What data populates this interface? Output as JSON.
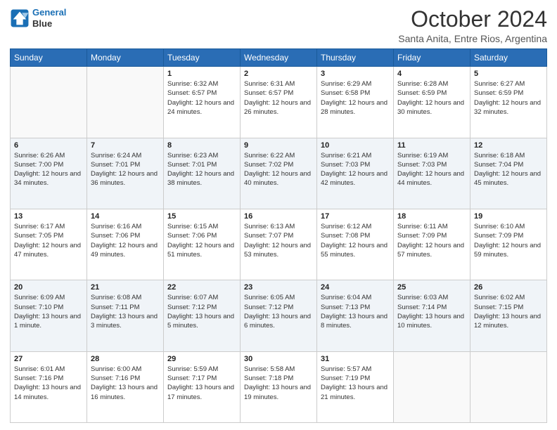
{
  "logo": {
    "line1": "General",
    "line2": "Blue"
  },
  "title": "October 2024",
  "subtitle": "Santa Anita, Entre Rios, Argentina",
  "days_of_week": [
    "Sunday",
    "Monday",
    "Tuesday",
    "Wednesday",
    "Thursday",
    "Friday",
    "Saturday"
  ],
  "weeks": [
    [
      {
        "day": "",
        "info": ""
      },
      {
        "day": "",
        "info": ""
      },
      {
        "day": "1",
        "info": "Sunrise: 6:32 AM\nSunset: 6:57 PM\nDaylight: 12 hours and 24 minutes."
      },
      {
        "day": "2",
        "info": "Sunrise: 6:31 AM\nSunset: 6:57 PM\nDaylight: 12 hours and 26 minutes."
      },
      {
        "day": "3",
        "info": "Sunrise: 6:29 AM\nSunset: 6:58 PM\nDaylight: 12 hours and 28 minutes."
      },
      {
        "day": "4",
        "info": "Sunrise: 6:28 AM\nSunset: 6:59 PM\nDaylight: 12 hours and 30 minutes."
      },
      {
        "day": "5",
        "info": "Sunrise: 6:27 AM\nSunset: 6:59 PM\nDaylight: 12 hours and 32 minutes."
      }
    ],
    [
      {
        "day": "6",
        "info": "Sunrise: 6:26 AM\nSunset: 7:00 PM\nDaylight: 12 hours and 34 minutes."
      },
      {
        "day": "7",
        "info": "Sunrise: 6:24 AM\nSunset: 7:01 PM\nDaylight: 12 hours and 36 minutes."
      },
      {
        "day": "8",
        "info": "Sunrise: 6:23 AM\nSunset: 7:01 PM\nDaylight: 12 hours and 38 minutes."
      },
      {
        "day": "9",
        "info": "Sunrise: 6:22 AM\nSunset: 7:02 PM\nDaylight: 12 hours and 40 minutes."
      },
      {
        "day": "10",
        "info": "Sunrise: 6:21 AM\nSunset: 7:03 PM\nDaylight: 12 hours and 42 minutes."
      },
      {
        "day": "11",
        "info": "Sunrise: 6:19 AM\nSunset: 7:03 PM\nDaylight: 12 hours and 44 minutes."
      },
      {
        "day": "12",
        "info": "Sunrise: 6:18 AM\nSunset: 7:04 PM\nDaylight: 12 hours and 45 minutes."
      }
    ],
    [
      {
        "day": "13",
        "info": "Sunrise: 6:17 AM\nSunset: 7:05 PM\nDaylight: 12 hours and 47 minutes."
      },
      {
        "day": "14",
        "info": "Sunrise: 6:16 AM\nSunset: 7:06 PM\nDaylight: 12 hours and 49 minutes."
      },
      {
        "day": "15",
        "info": "Sunrise: 6:15 AM\nSunset: 7:06 PM\nDaylight: 12 hours and 51 minutes."
      },
      {
        "day": "16",
        "info": "Sunrise: 6:13 AM\nSunset: 7:07 PM\nDaylight: 12 hours and 53 minutes."
      },
      {
        "day": "17",
        "info": "Sunrise: 6:12 AM\nSunset: 7:08 PM\nDaylight: 12 hours and 55 minutes."
      },
      {
        "day": "18",
        "info": "Sunrise: 6:11 AM\nSunset: 7:09 PM\nDaylight: 12 hours and 57 minutes."
      },
      {
        "day": "19",
        "info": "Sunrise: 6:10 AM\nSunset: 7:09 PM\nDaylight: 12 hours and 59 minutes."
      }
    ],
    [
      {
        "day": "20",
        "info": "Sunrise: 6:09 AM\nSunset: 7:10 PM\nDaylight: 13 hours and 1 minute."
      },
      {
        "day": "21",
        "info": "Sunrise: 6:08 AM\nSunset: 7:11 PM\nDaylight: 13 hours and 3 minutes."
      },
      {
        "day": "22",
        "info": "Sunrise: 6:07 AM\nSunset: 7:12 PM\nDaylight: 13 hours and 5 minutes."
      },
      {
        "day": "23",
        "info": "Sunrise: 6:05 AM\nSunset: 7:12 PM\nDaylight: 13 hours and 6 minutes."
      },
      {
        "day": "24",
        "info": "Sunrise: 6:04 AM\nSunset: 7:13 PM\nDaylight: 13 hours and 8 minutes."
      },
      {
        "day": "25",
        "info": "Sunrise: 6:03 AM\nSunset: 7:14 PM\nDaylight: 13 hours and 10 minutes."
      },
      {
        "day": "26",
        "info": "Sunrise: 6:02 AM\nSunset: 7:15 PM\nDaylight: 13 hours and 12 minutes."
      }
    ],
    [
      {
        "day": "27",
        "info": "Sunrise: 6:01 AM\nSunset: 7:16 PM\nDaylight: 13 hours and 14 minutes."
      },
      {
        "day": "28",
        "info": "Sunrise: 6:00 AM\nSunset: 7:16 PM\nDaylight: 13 hours and 16 minutes."
      },
      {
        "day": "29",
        "info": "Sunrise: 5:59 AM\nSunset: 7:17 PM\nDaylight: 13 hours and 17 minutes."
      },
      {
        "day": "30",
        "info": "Sunrise: 5:58 AM\nSunset: 7:18 PM\nDaylight: 13 hours and 19 minutes."
      },
      {
        "day": "31",
        "info": "Sunrise: 5:57 AM\nSunset: 7:19 PM\nDaylight: 13 hours and 21 minutes."
      },
      {
        "day": "",
        "info": ""
      },
      {
        "day": "",
        "info": ""
      }
    ]
  ]
}
